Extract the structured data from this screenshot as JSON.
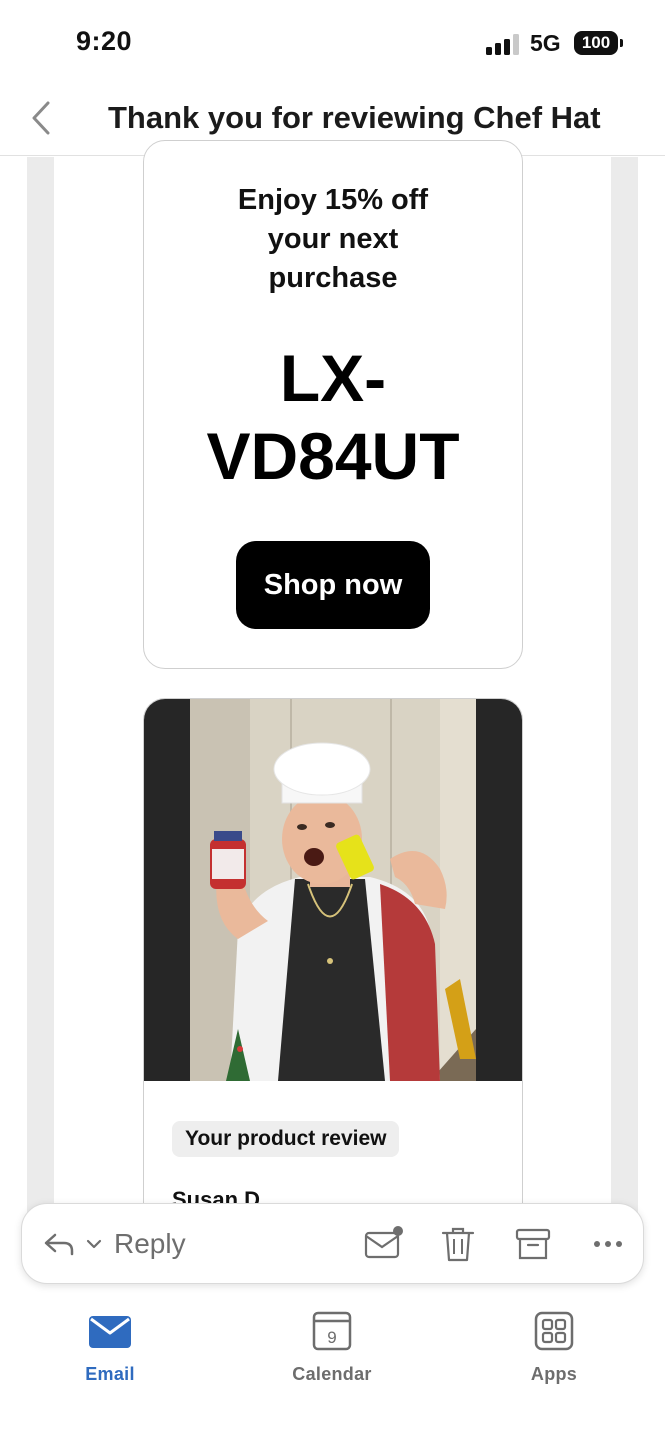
{
  "status_bar": {
    "time": "9:20",
    "network": "5G",
    "battery": "100"
  },
  "header": {
    "title": "Thank you for reviewing Chef Hat",
    "back_icon": "chevron-left-icon"
  },
  "coupon": {
    "offer_text": "Enjoy 15% off your next purchase",
    "code_line1": "LX-",
    "code_line2": "VD84UT",
    "button_label": "Shop now"
  },
  "review": {
    "photo_alt": "Customer photo wearing chef hat",
    "section_label": "Your product review",
    "reviewer_name": "Susan D"
  },
  "action_bar": {
    "reply_label": "Reply",
    "icons": [
      "reply-icon",
      "chevron-down-icon",
      "mark-unread-icon",
      "trash-icon",
      "archive-icon",
      "more-icon"
    ]
  },
  "bottom_nav": {
    "items": [
      {
        "label": "Email",
        "icon": "mail-icon",
        "active": true
      },
      {
        "label": "Calendar",
        "icon": "calendar-icon",
        "date": "9",
        "active": false
      },
      {
        "label": "Apps",
        "icon": "apps-grid-icon",
        "active": false
      }
    ]
  },
  "colors": {
    "accent": "#2f6bbf",
    "button_bg": "#000000",
    "page_gutter": "#ebebeb"
  }
}
